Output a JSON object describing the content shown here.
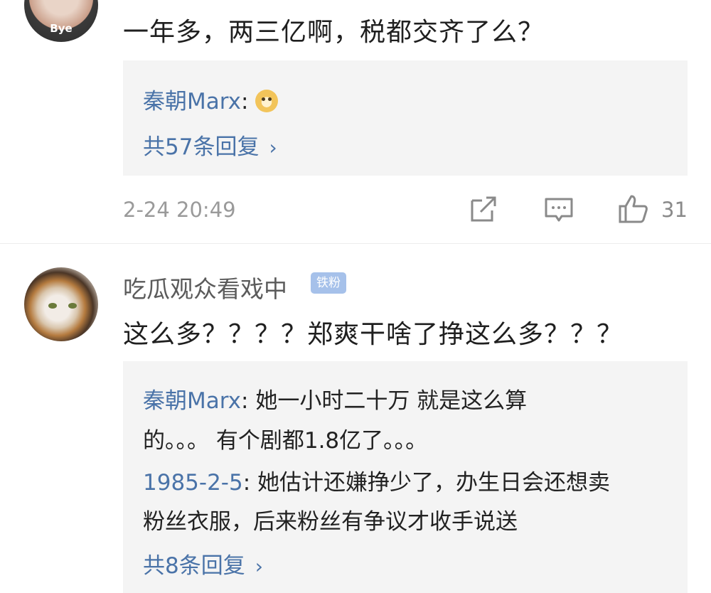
{
  "comment1": {
    "avatar_text": "Bye",
    "text": "一年多，两三亿啊，税都交齐了么？",
    "replies": [
      {
        "user": "秦朝Marx",
        "sep": ":",
        "content": ""
      }
    ],
    "more_replies": "共57条回复",
    "time": "2-24 20:49",
    "like_count": "31"
  },
  "comment2": {
    "nickname": "吃瓜观众看戏中",
    "badge": "铁粉",
    "text": "这么多？？？？郑爽干啥了挣这么多？？？",
    "replies": [
      {
        "user": "秦朝Marx",
        "sep": ":",
        "content_line1": " 她一小时二十万 就是这么算",
        "content_line2": "的。。。 有个剧都1.8亿了。。。"
      },
      {
        "user": "1985-2-5",
        "sep": ":",
        "content_line1": " 她估计还嫌挣少了，办生日会还想卖",
        "content_line2": "粉丝衣服，后来粉丝有争议才收手说送"
      }
    ],
    "more_replies": "共8条回复"
  },
  "icons": {
    "share": "share-icon",
    "comment": "comment-icon",
    "like": "thumbs-up-icon",
    "chevron": "chevron-right-icon",
    "emoji": "doge-emoji-icon"
  },
  "colors": {
    "link": "#4a73a8",
    "reply_bg": "#f4f4f4",
    "badge_bg": "#a6c1ea",
    "muted": "#9a9a9a"
  }
}
